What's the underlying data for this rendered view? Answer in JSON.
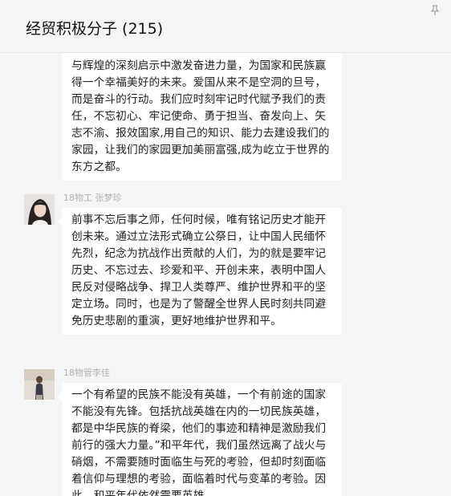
{
  "header": {
    "title": "经贸积极分子 (215)"
  },
  "messages": [
    {
      "text": "与辉煌的深刻启示中激发奋进力量，为国家和民族赢得一个幸福美好的未来。爱国从来不是空洞的旦号，而是奋斗的行动。我们应时刻牢记时代赋予我们的责任，不忘初心、牢记使命、勇于担当、奋发向上、矢志不渝、报效国家,用自己的知识、能力去建设我们的家园，让我们的家园更加美丽富强,成为屹立于世界的东方之都。"
    },
    {
      "sender": "18物工 张梦珍",
      "text": "前事不忘后事之师，任何时候，唯有铭记历史才能开创未来。通过立法形式确立公祭日，让中国人民缅怀先烈，纪念为抗战作出贡献的人们，为的就是要牢记历史、不忘过去、珍爱和平、开创未来，表明中国人民反对侵略战争、捍卫人类尊严、维护世界和平的坚定立场。同时，也是为了警醒全世界人民时刻共同避免历史悲剧的重演，更好地维护世界和平。"
    },
    {
      "sender": "18物管李佳",
      "text": "一个有希望的民族不能没有英雄，一个有前途的国家不能没有先锋。包括抗战英雄在内的一切民族英雄，都是中华民族的脊梁，他们的事迹和精神是激励我们前行的强大力量。”和平年代，我们虽然远离了战火与硝烟，不需要随时面临生与死的考验，但却时刻面临着信仰与理想的考验，面临着时代与变革的考验。因此，和平年代依然需要英雄。"
    }
  ],
  "colors": {
    "background": "#f5f5f5",
    "bubble": "#ffffff",
    "sender_name": "#b2b2b2",
    "text": "#222222"
  }
}
